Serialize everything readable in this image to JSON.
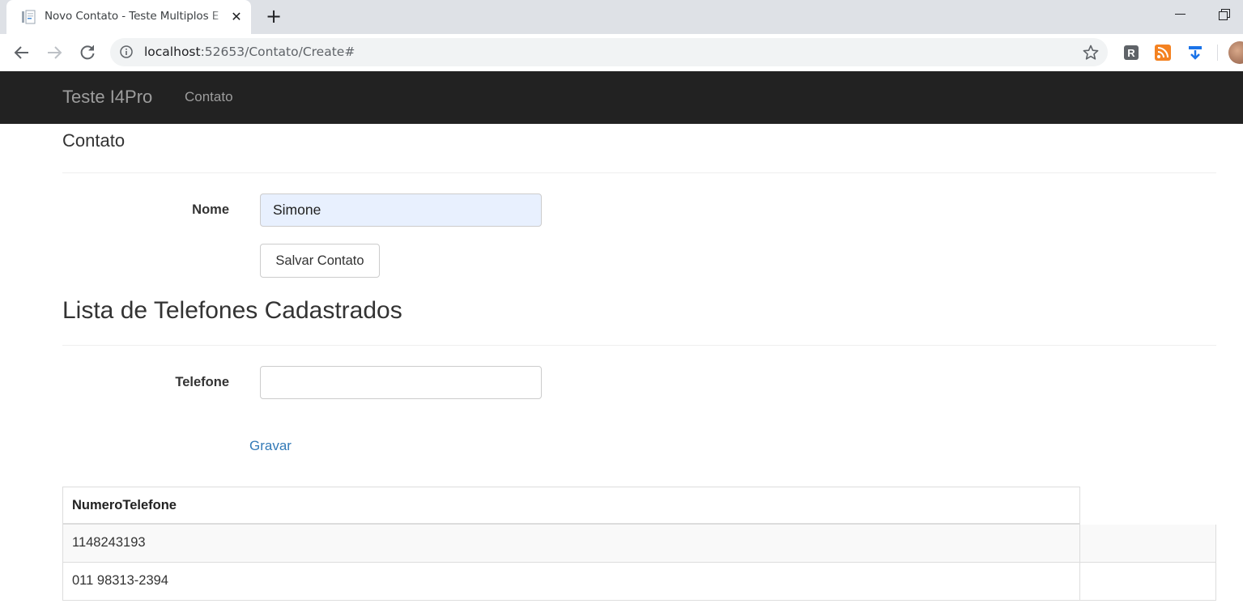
{
  "browser": {
    "tab_title": "Novo Contato - Teste Multiplos E",
    "tab_close": "✕",
    "new_tab": "+",
    "url_host": "localhost",
    "url_rest": ":52653/Contato/Create#"
  },
  "navbar": {
    "brand": "Teste I4Pro",
    "links": [
      "Contato"
    ],
    "background": "#222222"
  },
  "contato": {
    "heading": "Contato",
    "nome_label": "Nome",
    "nome_value": "Simone",
    "save_button": "Salvar Contato"
  },
  "telefones": {
    "heading": "Lista de Telefones Cadastrados",
    "telefone_label": "Telefone",
    "telefone_value": "",
    "gravar_link": "Gravar",
    "table_header": "NumeroTelefone",
    "rows": [
      "1148243193",
      "011 98313-2394"
    ]
  },
  "colors": {
    "link": "#337ab7",
    "autofill": "#e8f0fe"
  }
}
